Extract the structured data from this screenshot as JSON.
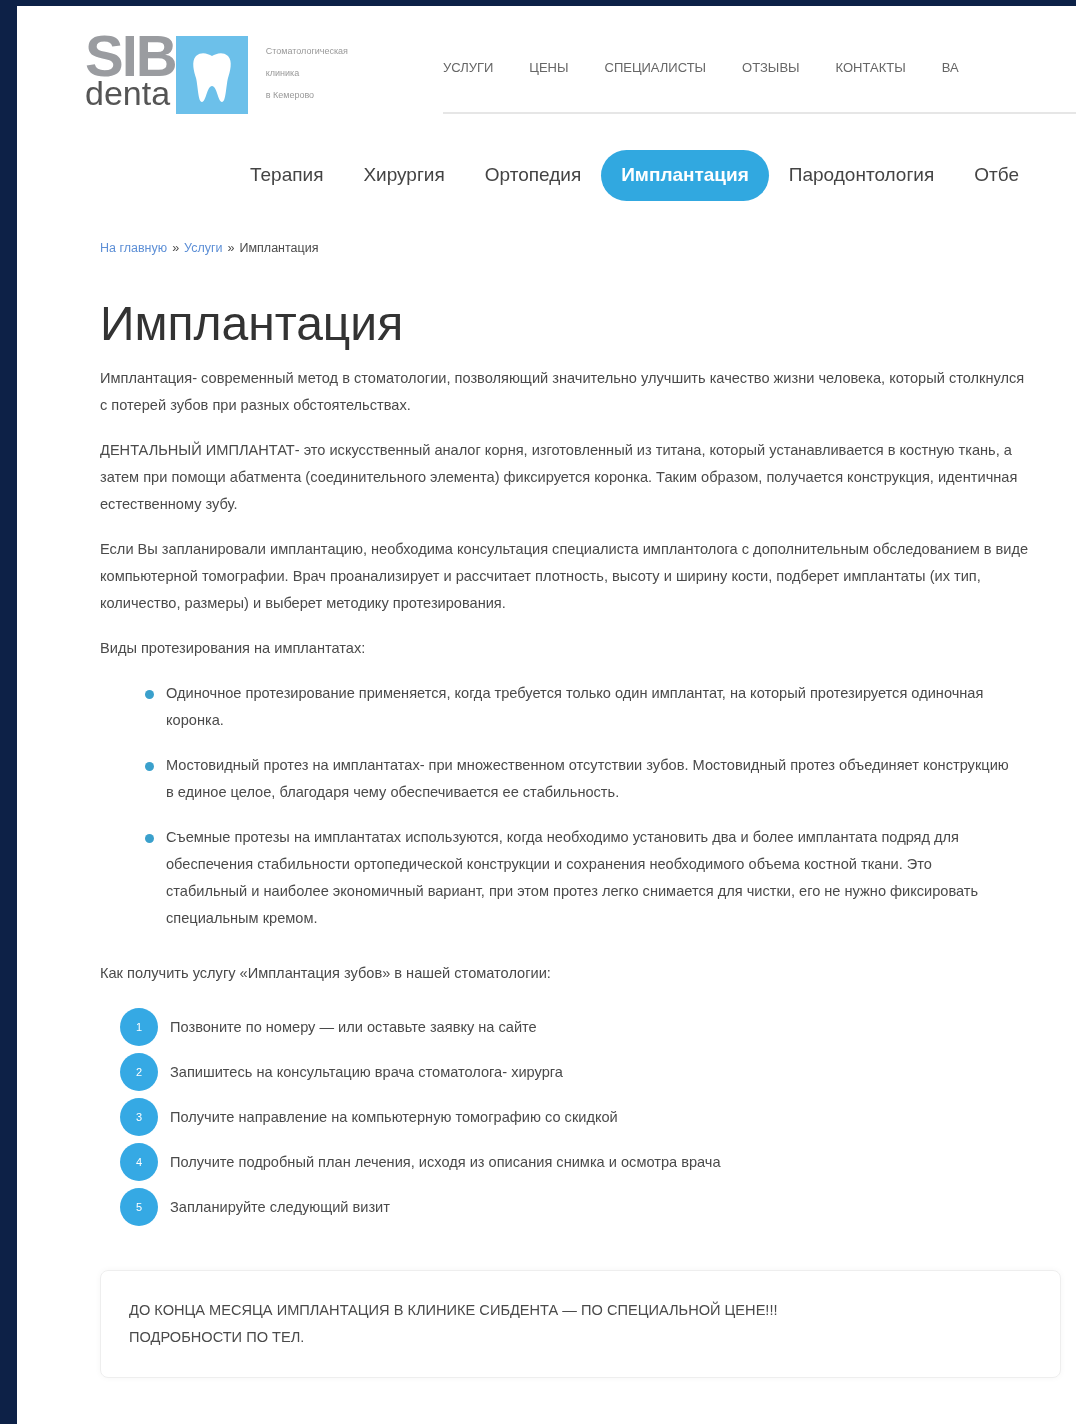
{
  "logo": {
    "brand_top": "SIB",
    "brand_bottom": "denta",
    "tagline": [
      "Стоматологическая",
      "клиника",
      "в Кемерово"
    ]
  },
  "top_nav": [
    "УСЛУГИ",
    "ЦЕНЫ",
    "СПЕЦИАЛИСТЫ",
    "ОТЗЫВЫ",
    "КОНТАКТЫ",
    "ВА"
  ],
  "service_tabs": [
    {
      "label": "Терапия",
      "selected": false
    },
    {
      "label": "Хирургия",
      "selected": false
    },
    {
      "label": "Ортопедия",
      "selected": false
    },
    {
      "label": "Имплантация",
      "selected": true
    },
    {
      "label": "Пародонтология",
      "selected": false
    },
    {
      "label": "Отбе",
      "selected": false
    }
  ],
  "breadcrumb": {
    "separator": "»",
    "items": [
      {
        "label": "На главную",
        "kind": "link"
      },
      {
        "label": "Услуги",
        "kind": "link"
      },
      {
        "label": "Имплантация",
        "kind": "current"
      }
    ]
  },
  "title": "Имплантация",
  "paragraphs": [
    "Имплантация- современный метод в стоматологии, позволяющий значительно улучшить качество жизни человека, который столкнулся с потерей зубов при разных обстоятельствах.",
    "ДЕНТАЛЬНЫЙ ИМПЛАНТАТ- это искусственный аналог корня, изготовленный из титана, который устанавливается в костную ткань, а затем при помощи абатмента (соединительного элемента) фиксируется коронка. Таким образом, получается конструкция, идентичная естественному зубу.",
    "Если Вы запланировали имплантацию, необходима консультация специалиста имплантолога с дополнительным обследованием в виде компьютерной томографии. Врач проанализирует и рассчитает плотность, высоту и ширину кости, подберет имплантаты (их тип, количество, размеры) и выберет методику протезирования."
  ],
  "list_intro": "Виды протезирования на имплантатах:",
  "bullets": [
    "Одиночное протезирование применяется, когда требуется только один имплантат, на который протезируется одиночная коронка.",
    "Мостовидный протез на имплантатах- при множественном отсутствии зубов. Мостовидный протез объединяет конструкцию в единое целое, благодаря чему обеспечивается ее стабильность.",
    "Съемные протезы на имплантатах используются, когда необходимо установить два и более имплантата подряд для обеспечения стабильности ортопедической конструкции и сохранения необходимого объема костной ткани. Это стабильный и наиболее экономичный вариант, при этом протез легко снимается для чистки, его не нужно фиксировать специальным кремом."
  ],
  "steps_intro": "Как получить услугу «Имплантация зубов» в нашей стоматологии:",
  "steps": [
    {
      "number": "1",
      "text": "Позвоните по номеру — или оставьте заявку на сайте"
    },
    {
      "number": "2",
      "text": "Запишитесь на консультацию врача стоматолога- хирурга"
    },
    {
      "number": "3",
      "text": "Получите направление на компьютерную томографию со скидкой"
    },
    {
      "number": "4",
      "text": "Получите подробный план лечения, исходя из описания снимка и осмотра врача"
    },
    {
      "number": "5",
      "text": "Запланируйте следующий визит"
    }
  ],
  "promo": [
    "ДО КОНЦА МЕСЯЦА ИМПЛАНТАЦИЯ В КЛИНИКЕ СИБДЕНТА — ПО СПЕЦИАЛЬНОЙ ЦЕНЕ!!!",
    "ПОДРОБНОСТИ ПО ТЕЛ."
  ]
}
